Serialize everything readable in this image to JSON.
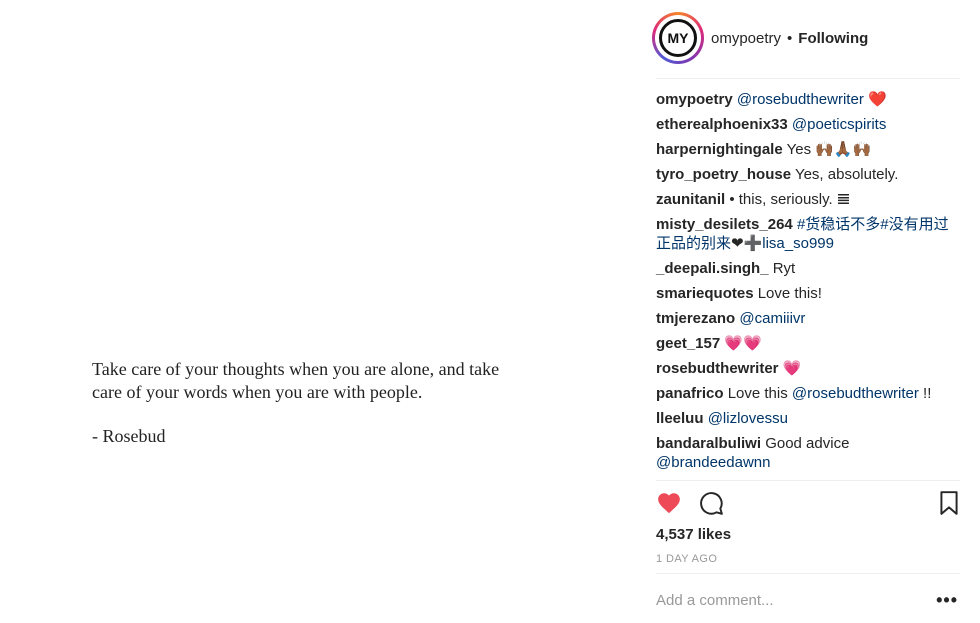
{
  "post": {
    "quote_line1": "Take care of your thoughts when you are alone, and take",
    "quote_line2": "care of your words when you are with people.",
    "author": "-  Rosebud"
  },
  "header": {
    "avatar_text": "MY",
    "username": "omypoetry",
    "separator": "•",
    "follow_state": "Following"
  },
  "comments": [
    {
      "user": "omypoetry",
      "parts": [
        {
          "t": "link",
          "v": "@rosebudthewriter"
        },
        {
          "t": "text",
          "v": " ❤️"
        }
      ]
    },
    {
      "user": "etherealphoenix33",
      "parts": [
        {
          "t": "link",
          "v": "@poeticspirits"
        }
      ]
    },
    {
      "user": "harpernightingale",
      "parts": [
        {
          "t": "text",
          "v": "Yes 🙌🏾🙏🏾🙌🏾"
        }
      ]
    },
    {
      "user": "tyro_poetry_house",
      "parts": [
        {
          "t": "text",
          "v": "Yes, absolutely."
        }
      ]
    },
    {
      "user": "zaunitanil",
      "parts": [
        {
          "t": "text",
          "v": "• this, seriously. 𝌆"
        }
      ]
    },
    {
      "user": "misty_desilets_264",
      "parts": [
        {
          "t": "link",
          "v": "#货稳话不多#没有用过正品的别来"
        },
        {
          "t": "text",
          "v": "❤➕"
        },
        {
          "t": "link",
          "v": "lisa_so999"
        }
      ]
    },
    {
      "user": "_deepali.singh_",
      "parts": [
        {
          "t": "text",
          "v": "Ryt"
        }
      ]
    },
    {
      "user": "smariequotes",
      "parts": [
        {
          "t": "text",
          "v": "Love this!"
        }
      ]
    },
    {
      "user": "tmjerezano",
      "parts": [
        {
          "t": "link",
          "v": "@camiiivr"
        }
      ]
    },
    {
      "user": "geet_157",
      "parts": [
        {
          "t": "text",
          "v": "💗💗"
        }
      ]
    },
    {
      "user": "rosebudthewriter",
      "parts": [
        {
          "t": "text",
          "v": "💗"
        }
      ]
    },
    {
      "user": "panafrico",
      "parts": [
        {
          "t": "text",
          "v": "Love this "
        },
        {
          "t": "link",
          "v": "@rosebudthewriter"
        },
        {
          "t": "text",
          "v": " !!"
        }
      ]
    },
    {
      "user": "lleeluu",
      "parts": [
        {
          "t": "link",
          "v": "@lizlovessu"
        }
      ]
    },
    {
      "user": "bandaralbuliwi",
      "parts": [
        {
          "t": "text",
          "v": "Good advice "
        },
        {
          "t": "link",
          "v": "@brandeedawnn"
        }
      ]
    }
  ],
  "actions": {
    "like_icon": "heart-filled-icon",
    "comment_icon": "comment-bubble-icon",
    "save_icon": "bookmark-icon",
    "like_color": "#ed4956"
  },
  "likes": "4,537 likes",
  "time_ago": "1 DAY AGO",
  "comment_box": {
    "placeholder": "Add a comment...",
    "value": "",
    "more_label": "•••"
  }
}
